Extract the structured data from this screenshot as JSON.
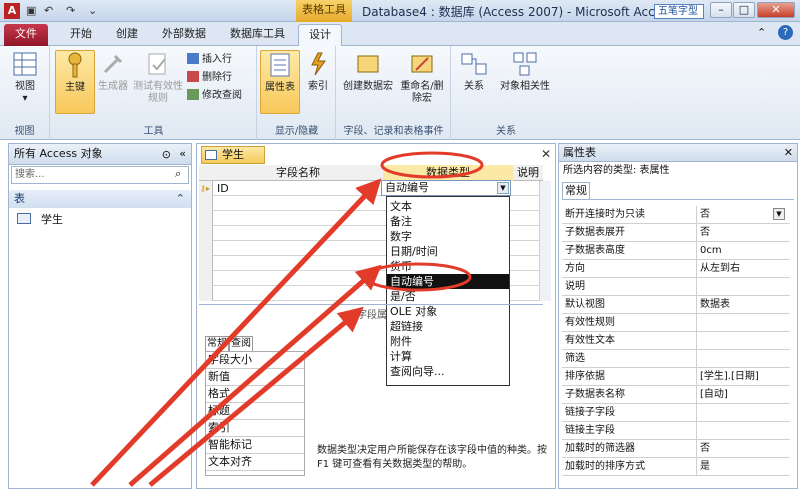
{
  "window": {
    "title": "Database4 : 数据库 (Access 2007)  -  Microsoft Access",
    "contextual_tab": "表格工具",
    "ime_badge": "五笔字型",
    "controls": [
      "minimize",
      "maximize",
      "close"
    ]
  },
  "tabs": [
    "文件",
    "开始",
    "创建",
    "外部数据",
    "数据库工具",
    "设计"
  ],
  "ribbon": {
    "groups": {
      "views": {
        "label": "视图",
        "buttons": [
          "视图"
        ]
      },
      "tools": {
        "label": "工具",
        "buttons": [
          "主键",
          "生成器",
          "测试有效性规则"
        ],
        "small": [
          "插入行",
          "删除行",
          "修改查阅"
        ]
      },
      "showhide": {
        "label": "显示/隐藏",
        "buttons": [
          "属性表",
          "索引"
        ]
      },
      "field_events": {
        "label": "字段、记录和表格事件",
        "buttons": [
          "创建数据宏",
          "重命名/删除宏"
        ]
      },
      "relationships": {
        "label": "关系",
        "buttons": [
          "关系",
          "对象相关性"
        ]
      }
    }
  },
  "nav": {
    "header": "所有 Access 对象",
    "search_placeholder": "搜索...",
    "category": "表",
    "items": [
      "学生"
    ]
  },
  "design": {
    "tab": "学生",
    "columns": [
      "字段名称",
      "数据类型",
      "说明"
    ],
    "rows": [
      {
        "name": "ID",
        "type": "自动编号"
      }
    ],
    "dropdown": [
      "文本",
      "备注",
      "数字",
      "日期/时间",
      "货币",
      "自动编号",
      "是/否",
      "OLE 对象",
      "超链接",
      "附件",
      "计算",
      "查阅向导..."
    ],
    "selected_type": "自动编号",
    "field_props_label": "字段属",
    "prop_tabs": [
      "常规",
      "查阅"
    ],
    "field_props": [
      "字段大小",
      "新值",
      "格式",
      "标题",
      "索引",
      "智能标记",
      "文本对齐"
    ],
    "help": "数据类型决定用户所能保存在该字段中值的种类。按 F1 键可查看有关数据类型的帮助。"
  },
  "propsheet": {
    "title": "属性表",
    "selection": "所选内容的类型: 表属性",
    "tab": "常规",
    "rows": [
      {
        "k": "断开连接时为只读",
        "v": "否"
      },
      {
        "k": "子数据表展开",
        "v": "否"
      },
      {
        "k": "子数据表高度",
        "v": "0cm"
      },
      {
        "k": "方向",
        "v": "从左到右"
      },
      {
        "k": "说明",
        "v": ""
      },
      {
        "k": "默认视图",
        "v": "数据表"
      },
      {
        "k": "有效性规则",
        "v": ""
      },
      {
        "k": "有效性文本",
        "v": ""
      },
      {
        "k": "筛选",
        "v": ""
      },
      {
        "k": "排序依据",
        "v": "[学生].[日期]"
      },
      {
        "k": "子数据表名称",
        "v": "[自动]"
      },
      {
        "k": "链接子字段",
        "v": ""
      },
      {
        "k": "链接主字段",
        "v": ""
      },
      {
        "k": "加载时的筛选器",
        "v": "否"
      },
      {
        "k": "加载时的排序方式",
        "v": "是"
      }
    ]
  },
  "colors": {
    "accent": "#c6364a",
    "highlight": "#f6c95a",
    "annotation": "#e23b2a"
  }
}
